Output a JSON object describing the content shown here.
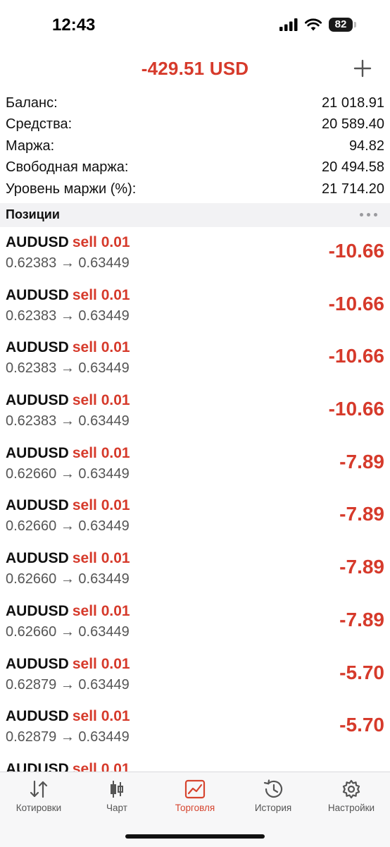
{
  "status_bar": {
    "time": "12:43",
    "battery": "82"
  },
  "header": {
    "total": "-429.51 USD"
  },
  "summary": [
    {
      "label": "Баланс:",
      "value": "21 018.91"
    },
    {
      "label": "Средства:",
      "value": "20 589.40"
    },
    {
      "label": "Маржа:",
      "value": "94.82"
    },
    {
      "label": "Свободная маржа:",
      "value": "20 494.58"
    },
    {
      "label": "Уровень маржи (%):",
      "value": "21 714.20"
    }
  ],
  "positions_title": "Позиции",
  "positions": [
    {
      "symbol": "AUDUSD",
      "side": "sell 0.01",
      "prices": "0.62383 → 0.63449",
      "profit": "-10.66"
    },
    {
      "symbol": "AUDUSD",
      "side": "sell 0.01",
      "prices": "0.62383 → 0.63449",
      "profit": "-10.66"
    },
    {
      "symbol": "AUDUSD",
      "side": "sell 0.01",
      "prices": "0.62383 → 0.63449",
      "profit": "-10.66"
    },
    {
      "symbol": "AUDUSD",
      "side": "sell 0.01",
      "prices": "0.62383 → 0.63449",
      "profit": "-10.66"
    },
    {
      "symbol": "AUDUSD",
      "side": "sell 0.01",
      "prices": "0.62660 → 0.63449",
      "profit": "-7.89"
    },
    {
      "symbol": "AUDUSD",
      "side": "sell 0.01",
      "prices": "0.62660 → 0.63449",
      "profit": "-7.89"
    },
    {
      "symbol": "AUDUSD",
      "side": "sell 0.01",
      "prices": "0.62660 → 0.63449",
      "profit": "-7.89"
    },
    {
      "symbol": "AUDUSD",
      "side": "sell 0.01",
      "prices": "0.62660 → 0.63449",
      "profit": "-7.89"
    },
    {
      "symbol": "AUDUSD",
      "side": "sell 0.01",
      "prices": "0.62879 → 0.63449",
      "profit": "-5.70"
    },
    {
      "symbol": "AUDUSD",
      "side": "sell 0.01",
      "prices": "0.62879 → 0.63449",
      "profit": "-5.70"
    },
    {
      "symbol": "AUDUSD",
      "side": "sell 0.01",
      "prices": "",
      "profit": ""
    }
  ],
  "tabs": [
    {
      "label": "Котировки",
      "icon": "quotes-arrows-icon",
      "active": false
    },
    {
      "label": "Чарт",
      "icon": "candlestick-chart-icon",
      "active": false
    },
    {
      "label": "Торговля",
      "icon": "trade-chart-icon",
      "active": true
    },
    {
      "label": "История",
      "icon": "history-clock-icon",
      "active": false
    },
    {
      "label": "Настройки",
      "icon": "gear-icon",
      "active": false
    }
  ],
  "colors": {
    "loss": "#d63a2b",
    "active_tab": "#d6452f"
  }
}
